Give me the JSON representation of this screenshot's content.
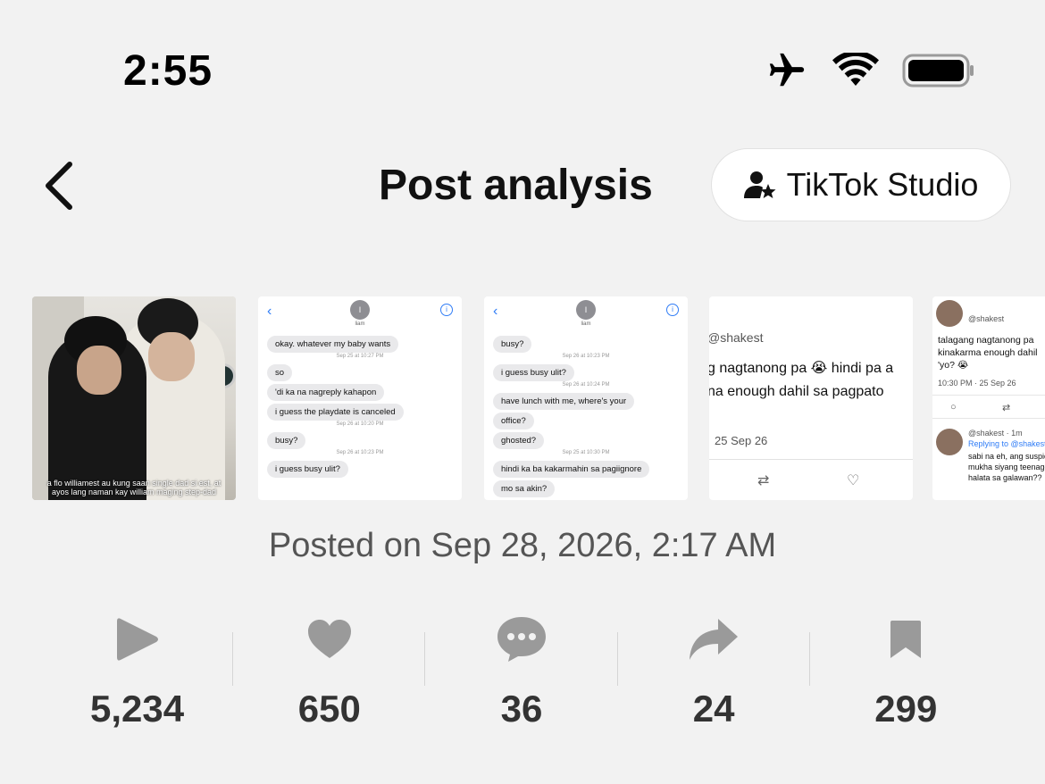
{
  "status_bar": {
    "time": "2:55",
    "icons": [
      "airplane-icon",
      "wifi-icon",
      "battery-icon"
    ]
  },
  "header": {
    "back_icon": "chevron-left-icon",
    "title": "Post analysis",
    "studio_button": {
      "icon": "creator-star-icon",
      "label": "TikTok Studio"
    }
  },
  "thumbnails": [
    {
      "type": "photo",
      "caption": "a flo williamest au kung saan single dad si est, at ayos lang naman kay william maging step-dad"
    },
    {
      "type": "imessage",
      "avatar_letter": "I",
      "contact": "liam",
      "items": [
        {
          "kind": "bubble",
          "text": "okay. whatever my baby wants"
        },
        {
          "kind": "stamp",
          "text": "Sep 25 at 10:27 PM"
        },
        {
          "kind": "bubble",
          "text": "so"
        },
        {
          "kind": "bubble",
          "text": "'di ka na nagreply kahapon"
        },
        {
          "kind": "bubble",
          "text": "i guess the playdate is canceled"
        },
        {
          "kind": "stamp",
          "text": "Sep 26 at 10:20 PM"
        },
        {
          "kind": "bubble",
          "text": "busy?"
        },
        {
          "kind": "stamp",
          "text": "Sep 26 at 10:23 PM"
        },
        {
          "kind": "bubble",
          "text": "i guess busy ulit?"
        }
      ]
    },
    {
      "type": "imessage",
      "avatar_letter": "I",
      "contact": "liam",
      "items": [
        {
          "kind": "bubble",
          "text": "busy?"
        },
        {
          "kind": "stamp",
          "text": "Sep 26 at 10:23 PM"
        },
        {
          "kind": "bubble",
          "text": "i guess busy ulit?"
        },
        {
          "kind": "stamp",
          "text": "Sep 26 at 10:24 PM"
        },
        {
          "kind": "bubble",
          "text": "have lunch with me, where's your"
        },
        {
          "kind": "bubble",
          "text": "office?"
        },
        {
          "kind": "bubble",
          "text": "ghosted?"
        },
        {
          "kind": "stamp",
          "text": "Sep 25 at 10:30 PM"
        },
        {
          "kind": "bubble",
          "text": "hindi ka ba kakarmahin sa pagiignore"
        },
        {
          "kind": "bubble",
          "text": "mo sa akin?"
        }
      ]
    },
    {
      "type": "tweet",
      "handle": "@shakest",
      "line1": "g nagtanong pa 😭 hindi pa a",
      "line2": "na enough dahil sa pagpato",
      "date": "25 Sep 26"
    },
    {
      "type": "tweet-thread",
      "handle": "@shakest",
      "line1": "talagang nagtanong pa",
      "line2": "kinakarma enough dahil",
      "line3": "'yo? 😭",
      "date": "10:30 PM · 25 Sep 26",
      "reply_header": "@shakest · 1m",
      "reply_to": "Replying to @shakest",
      "reply1": "sabi na eh, ang suspic",
      "reply2": "mukha siyang teenage",
      "reply3": "halata sa galawan??"
    }
  ],
  "posted_on": "Posted on Sep 28, 2026, 2:17 AM",
  "stats": [
    {
      "icon": "play-icon",
      "value": "5,234",
      "name": "views"
    },
    {
      "icon": "heart-icon",
      "value": "650",
      "name": "likes"
    },
    {
      "icon": "comment-icon",
      "value": "36",
      "name": "comments"
    },
    {
      "icon": "share-icon",
      "value": "24",
      "name": "shares"
    },
    {
      "icon": "bookmark-icon",
      "value": "299",
      "name": "saves"
    }
  ],
  "colors": {
    "background": "#f2f2f2",
    "stat_icon": "#9a9a9a",
    "stat_value": "#333333",
    "link_blue": "#2f7cf6"
  }
}
